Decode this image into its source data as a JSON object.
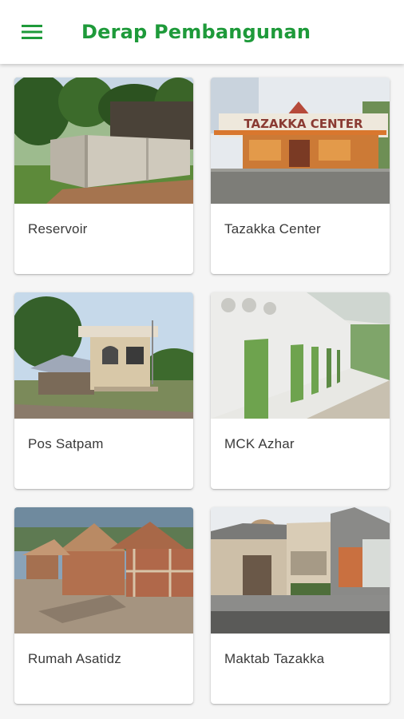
{
  "app": {
    "title": "Derap Pembangunan",
    "accent_color": "#1e9a3a",
    "menu_icon": "menu-icon"
  },
  "cards": [
    {
      "label": "Reservoir"
    },
    {
      "label": "Tazakka Center",
      "sign_text": "TAZAKKA CENTER"
    },
    {
      "label": "Pos Satpam"
    },
    {
      "label": "MCK Azhar"
    },
    {
      "label": "Rumah Asatidz"
    },
    {
      "label": "Maktab Tazakka"
    }
  ]
}
